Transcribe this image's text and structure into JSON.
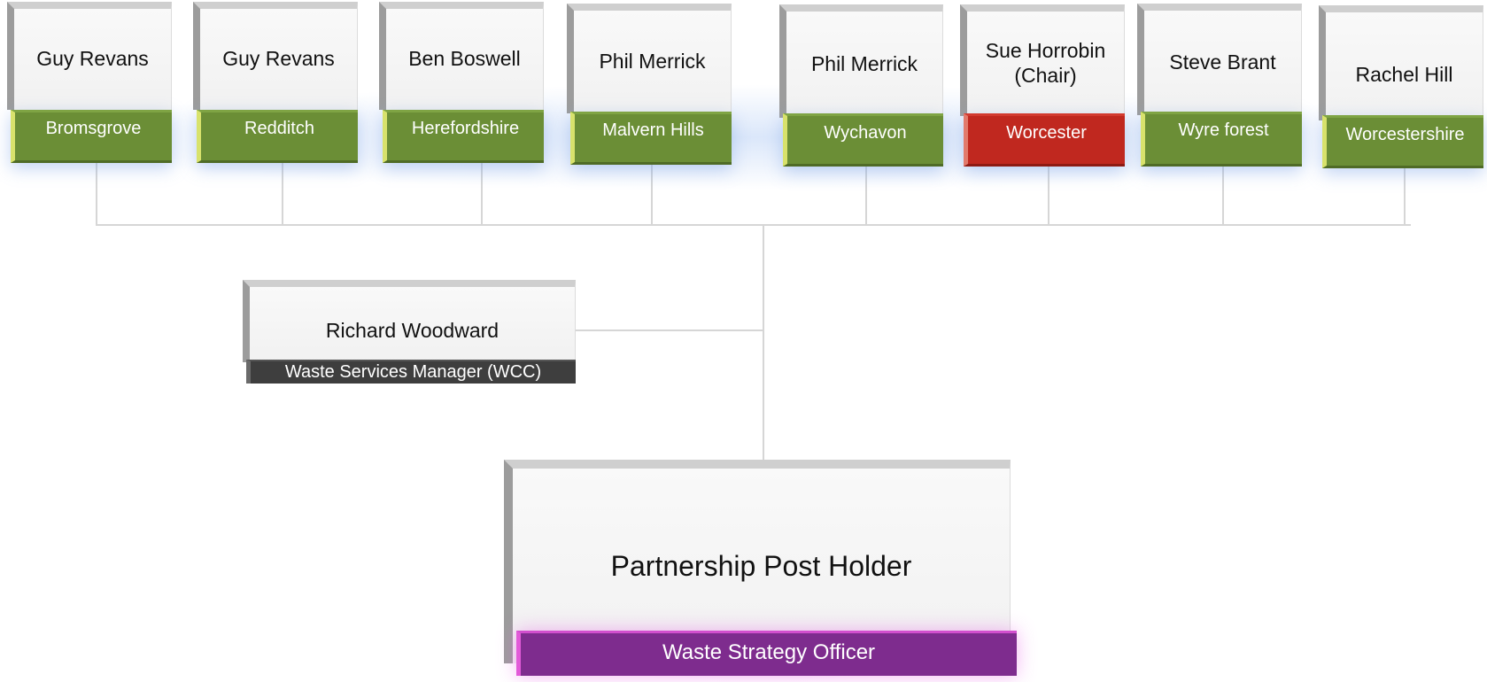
{
  "members": [
    {
      "name": "Guy Revans",
      "area": "Bromsgrove",
      "color": "#6b8e36"
    },
    {
      "name": "Guy Revans",
      "area": "Redditch",
      "color": "#6b8e36"
    },
    {
      "name": "Ben Boswell",
      "area": "Herefordshire",
      "color": "#6b8e36"
    },
    {
      "name": "Phil Merrick",
      "area": "Malvern Hills",
      "color": "#6b8e36"
    },
    {
      "name": "Phil Merrick",
      "area": "Wychavon",
      "color": "#6b8e36"
    },
    {
      "name": "Sue Horrobin (Chair)",
      "area": "Worcester",
      "color": "#c0281f"
    },
    {
      "name": "Steve Brant",
      "area": "Wyre forest",
      "color": "#6b8e36"
    },
    {
      "name": "Rachel Hill",
      "area": "Worcestershire",
      "color": "#6b8e36"
    }
  ],
  "manager": {
    "name": "Richard Woodward",
    "role": "Waste Services Manager (WCC)"
  },
  "post": {
    "name": "Partnership Post Holder",
    "role": "Waste Strategy Officer"
  }
}
